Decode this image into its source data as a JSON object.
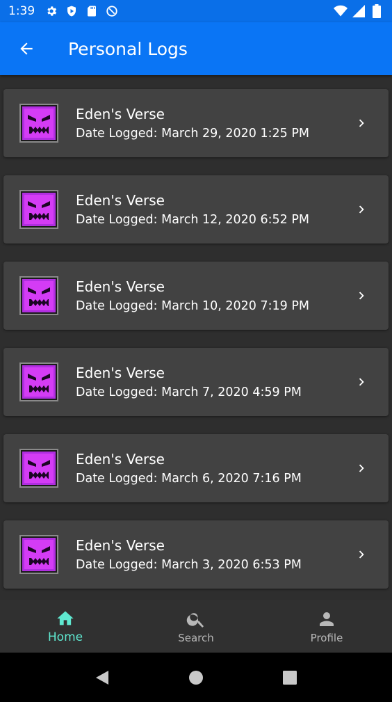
{
  "status_bar": {
    "time": "1:39",
    "left_icons": [
      "gear-icon",
      "shield-play-icon",
      "sd-card-icon",
      "at-sign-icon"
    ],
    "right_icons": [
      "wifi-icon",
      "signal-icon",
      "battery-icon"
    ]
  },
  "app_bar": {
    "title": "Personal Logs",
    "background": "#0a75f5"
  },
  "logs": [
    {
      "title": "Eden's Verse",
      "date": "Date Logged: March 29, 2020 1:25 PM"
    },
    {
      "title": "Eden's Verse",
      "date": "Date Logged: March 12, 2020 6:52 PM"
    },
    {
      "title": "Eden's Verse",
      "date": "Date Logged: March 10, 2020 7:19 PM"
    },
    {
      "title": "Eden's Verse",
      "date": "Date Logged: March 7, 2020 4:59 PM"
    },
    {
      "title": "Eden's Verse",
      "date": "Date Logged: March 6, 2020 7:16 PM"
    },
    {
      "title": "Eden's Verse",
      "date": "Date Logged: March 3, 2020 6:53 PM"
    }
  ],
  "bottom_nav": {
    "items": [
      {
        "label": "Home",
        "icon": "home-icon",
        "active": true
      },
      {
        "label": "Search",
        "icon": "search-icon",
        "active": false
      },
      {
        "label": "Profile",
        "icon": "person-icon",
        "active": false
      }
    ],
    "active_color": "#5fe8d0"
  },
  "system_nav": [
    "back-triangle-icon",
    "home-circle-icon",
    "recents-square-icon"
  ]
}
